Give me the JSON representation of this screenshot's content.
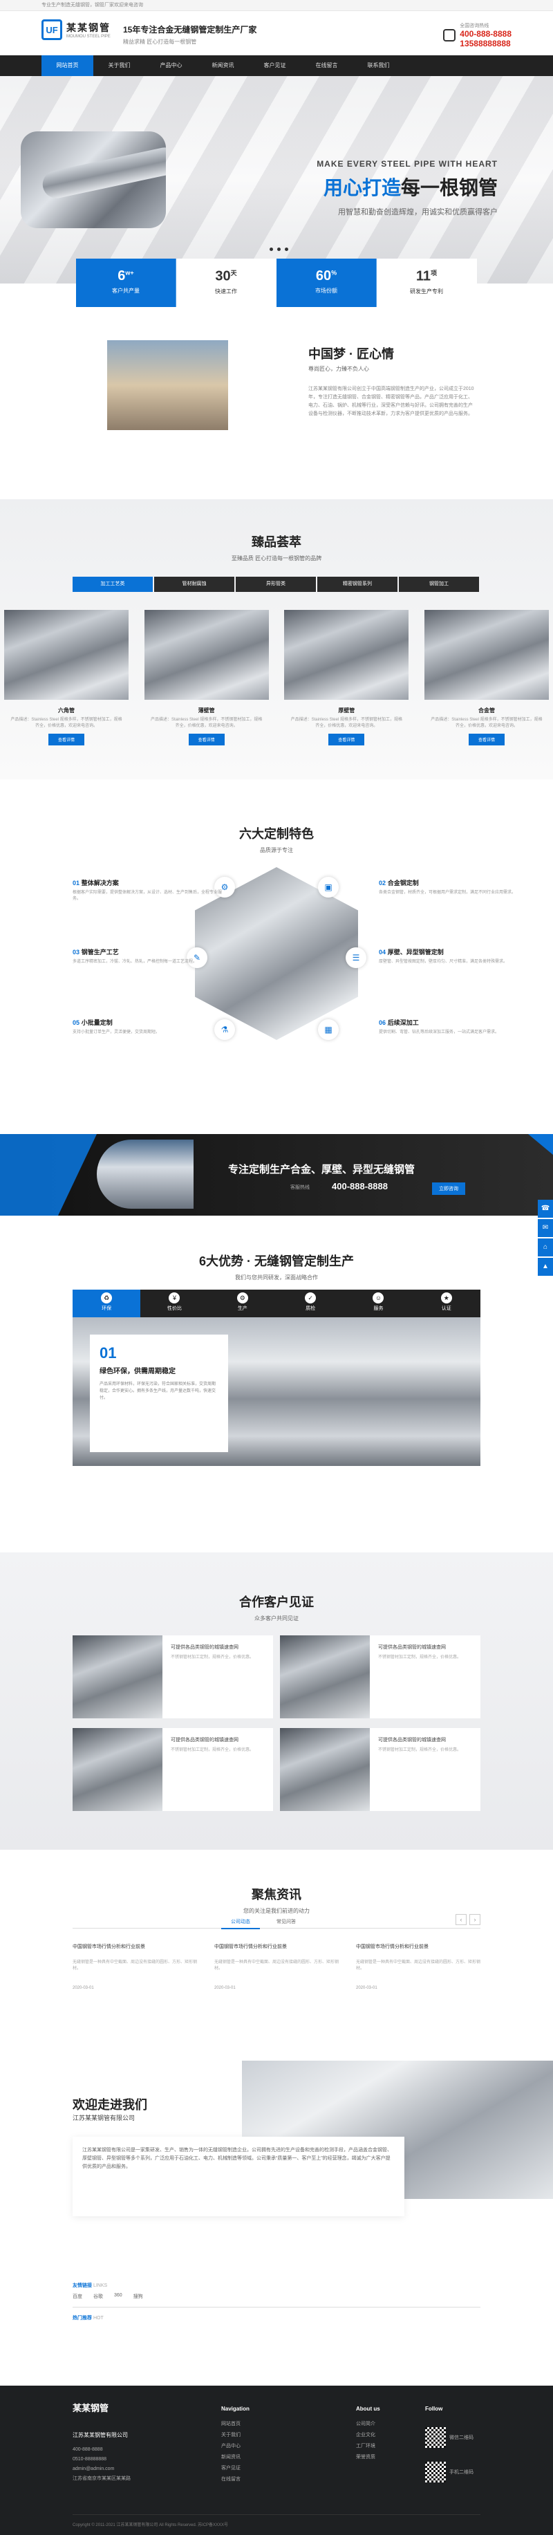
{
  "topstrip": {
    "text": "专业生产制造无缝钢管，钢管厂家欢迎来电咨询"
  },
  "header": {
    "logo_cn": "某某钢管",
    "logo_en": "MOUMOU STEEL PIPE",
    "slogan_main": "15年专注合金无缝钢管定制生产厂家",
    "slogan_sub": "精益求精 匠心打造每一根钢管",
    "hotline_label": "全国咨询热线",
    "phone_1": "400-888-8888",
    "phone_2": "13588888888"
  },
  "nav": {
    "items": [
      "网站首页",
      "关于我们",
      "产品中心",
      "新闻资讯",
      "客户见证",
      "在线留言",
      "联系我们"
    ]
  },
  "banner": {
    "en": "MAKE EVERY STEEL PIPE WITH HEART",
    "cn_prefix": "用心打造",
    "cn_suffix": "每一根钢管",
    "sub": "用智慧和勤奋创造辉煌，用诚实和优质赢得客户"
  },
  "stats": [
    {
      "num": "6",
      "unit": "w+",
      "label": "客户共产量"
    },
    {
      "num": "30",
      "unit": "天",
      "label": "快速工作"
    },
    {
      "num": "60",
      "unit": "%",
      "label": "市场份额"
    },
    {
      "num": "11",
      "unit": "项",
      "label": "研发生产专利"
    }
  ],
  "about": {
    "title": "中国梦 · 匠心情",
    "sub": "尊尚匠心，力臻不负人心",
    "para": "江苏某某钢管有限公司创立于中国高端钢管制造生产的产业，公司成立于2010年，专注打造无缝钢管、合金钢管、精密钢管等产品，产品广泛应用于化工、电力、石油、锅炉、机械等行业，深受客户信赖与好评。公司拥有完善的生产设备与检测仪器，不断推动技术革新，力求为客户提供更优质的产品与服务。"
  },
  "products": {
    "title": "臻品荟萃",
    "sub": "至臻品质 匠心打造每一根钢管的品牌",
    "tabs": [
      "加工工艺类",
      "管材耐腐蚀",
      "异形管类",
      "精密钢管系列",
      "钢管加工"
    ],
    "items": [
      {
        "name": "六角管",
        "desc": "产品描述：Stainless Steel 规格多样，不锈钢管材加工，规格齐全，价格优惠，欢迎来电咨询。",
        "btn": "查看详情"
      },
      {
        "name": "薄壁管",
        "desc": "产品描述：Stainless Steel 规格多样，不锈钢管材加工，规格齐全，价格优惠，欢迎来电咨询。",
        "btn": "查看详情"
      },
      {
        "name": "厚壁管",
        "desc": "产品描述：Stainless Steel 规格多样，不锈钢管材加工，规格齐全，价格优惠，欢迎来电咨询。",
        "btn": "查看详情"
      },
      {
        "name": "合金管",
        "desc": "产品描述：Stainless Steel 规格多样，不锈钢管材加工，规格齐全，价格优惠，欢迎来电咨询。",
        "btn": "查看详情"
      }
    ]
  },
  "features": {
    "title": "六大定制特色",
    "sub": "品质源于专注",
    "items": [
      {
        "num": "01",
        "title": "整体解决方案",
        "desc": "根据客户实际需要，提供整体解决方案，从设计、选材、生产到售后，全程专业服务。"
      },
      {
        "num": "02",
        "title": "合金钢定制",
        "desc": "各类合金钢管，材质齐全，可根据用户需求定制，满足不同行业应用需求。"
      },
      {
        "num": "03",
        "title": "钢管生产工艺",
        "desc": "多道工序精密加工，冷拔、冷轧、热轧，严格控制每一道工艺流程。"
      },
      {
        "num": "04",
        "title": "厚壁、异型钢管定制",
        "desc": "厚壁管、异型管按图定制，壁厚均匀、尺寸精准，满足各类特殊需求。"
      },
      {
        "num": "05",
        "title": "小批量定制",
        "desc": "支持小批量订单生产，灵活便捷，交货周期短。"
      },
      {
        "num": "06",
        "title": "后续深加工",
        "desc": "提供切割、弯管、钻孔等后续深加工服务，一站式满足客户需求。"
      }
    ]
  },
  "darkbar": {
    "text": "专注定制生产合金、厚壁、异型无缝钢管",
    "hotline_label": "客服热线",
    "phone": "400-888-8888",
    "button": "立即咨询"
  },
  "side": [
    "☎",
    "✉",
    "⌂",
    "▲"
  ],
  "advantages": {
    "title": "6大优势 · 无缝钢管定制生产",
    "sub": "我们与您共同研发，深面战略合作",
    "icons": [
      "环保",
      "性价比",
      "生产",
      "质检",
      "服务",
      "认证"
    ],
    "card_num": "01",
    "card_title": "绿色环保，供需周期稳定",
    "card_desc": "产品采用环保材料，环保无污染，符合国家相关标准，交货周期稳定，合作更安心。拥有多条生产线，月产量达数千吨，快速交付。"
  },
  "clients": {
    "title": "合作客户见证",
    "sub": "众多客户共同见证",
    "items": [
      {
        "title": "可提供各品类钢管的城镇速查网",
        "desc": "不锈钢管材加工定制，规格齐全，价格优惠。"
      },
      {
        "title": "可提供各品类钢管的城镇速查网",
        "desc": "不锈钢管材加工定制，规格齐全，价格优惠。"
      },
      {
        "title": "可提供各品类钢管的城镇速查网",
        "desc": "不锈钢管材加工定制，规格齐全，价格优惠。"
      },
      {
        "title": "可提供各品类钢管的城镇速查网",
        "desc": "不锈钢管材加工定制，规格齐全，价格优惠。"
      }
    ]
  },
  "news": {
    "title": "聚焦资讯",
    "sub": "您的关注是我们前进的动力",
    "tabs": [
      "公司动态",
      "常见问答"
    ],
    "items": [
      {
        "title": "中国钢管市场行情分析和行业前景",
        "desc": "无缝钢管是一种具有中空截面、周边没有接缝的圆形、方形、矩形钢材。",
        "date": "2020-03-01"
      },
      {
        "title": "中国钢管市场行情分析和行业前景",
        "desc": "无缝钢管是一种具有中空截面、周边没有接缝的圆形、方形、矩形钢材。",
        "date": "2020-03-01"
      },
      {
        "title": "中国钢管市场行情分析和行业前景",
        "desc": "无缝钢管是一种具有中空截面、周边没有接缝的圆形、方形、矩形钢材。",
        "date": "2020-03-01"
      }
    ]
  },
  "welcome": {
    "title": "欢迎走进我们",
    "sub": "江苏某某钢管有限公司",
    "para": "江苏某某钢管有限公司是一家集研发、生产、销售为一体的无缝钢管制造企业。公司拥有先进的生产设备和完善的检测手段，产品涵盖合金钢管、厚壁钢管、异型钢管等多个系列，广泛应用于石油化工、电力、机械制造等领域。公司秉承“质量第一、客户至上”的经营理念，竭诚为广大客户提供优质的产品和服务。"
  },
  "links": {
    "title": "友情链接",
    "title_en": "LINKS",
    "items": [
      "百度",
      "谷歌",
      "360",
      "搜狗"
    ],
    "title2": "热门推荐",
    "title2_en": "HOT"
  },
  "footer": {
    "logo": "某某钢管",
    "company": "江苏某某钢管有限公司",
    "contacts": [
      "400-888-8888",
      "0510-88888888",
      "admin@admin.com",
      "江苏省南京市某某区某某路"
    ],
    "col1_title": "Navigation",
    "col1_items": [
      "网站首页",
      "关于我们",
      "产品中心",
      "新闻资讯",
      "客户见证",
      "在线留言"
    ],
    "col2_title": "About us",
    "col2_items": [
      "公司简介",
      "企业文化",
      "工厂环境",
      "荣誉资质"
    ],
    "col3_title": "Follow",
    "qr1": "微信二维码",
    "qr2": "手机二维码",
    "copyright": "Copyright © 2011-2021 江苏某某钢管有限公司 All Rights Reserved. 苏ICP备XXXX号"
  }
}
